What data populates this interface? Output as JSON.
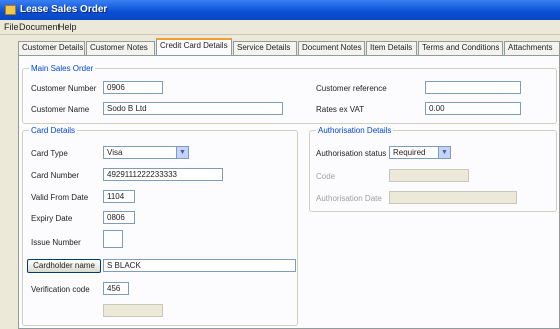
{
  "window": {
    "title": "Lease Sales Order"
  },
  "menu": [
    "File",
    "Document",
    "Help"
  ],
  "tabs": [
    {
      "label": "Customer Details",
      "active": false
    },
    {
      "label": "Customer Notes",
      "active": false
    },
    {
      "label": "Credit Card Details",
      "active": true
    },
    {
      "label": "Service Details",
      "active": false
    },
    {
      "label": "Document Notes",
      "active": false
    },
    {
      "label": "Item Details",
      "active": false
    },
    {
      "label": "Terms and Conditions",
      "active": false
    },
    {
      "label": "Attachments",
      "active": false
    }
  ],
  "main_sales_order": {
    "legend": "Main Sales Order",
    "customer_number": {
      "label": "Customer Number",
      "value": "0906"
    },
    "customer_name": {
      "label": "Customer Name",
      "value": "Sodo B Ltd"
    },
    "customer_reference": {
      "label": "Customer reference",
      "value": ""
    },
    "rates_vat": {
      "label": "Rates ex VAT",
      "value": "0.00"
    }
  },
  "card_details": {
    "legend": "Card Details",
    "card_type": {
      "label": "Card Type",
      "value": "Visa"
    },
    "card_number": {
      "label": "Card Number",
      "value": "4929111222233333"
    },
    "valid_from": {
      "label": "Valid From Date",
      "value": "1104"
    },
    "expiry": {
      "label": "Expiry Date",
      "value": "0806"
    },
    "issue_number": {
      "label": "Issue Number",
      "value": ""
    },
    "cardholder_name": {
      "label": "Cardholder name",
      "value": "S BLACK"
    },
    "verification_code": {
      "label": "Verification code",
      "value": "456"
    },
    "disabled_field": {
      "label": "",
      "value": ""
    }
  },
  "authorisation": {
    "legend": "Authorisation Details",
    "status": {
      "label": "Authorisation status",
      "value": "Required"
    },
    "code": {
      "label": "Code",
      "value": ""
    },
    "date": {
      "label": "Authorisation Date",
      "value": ""
    }
  },
  "colors": {
    "title_bar": "#0a4fd4",
    "legend_text": "#0046d5",
    "tab_highlight": "#f0a030"
  }
}
